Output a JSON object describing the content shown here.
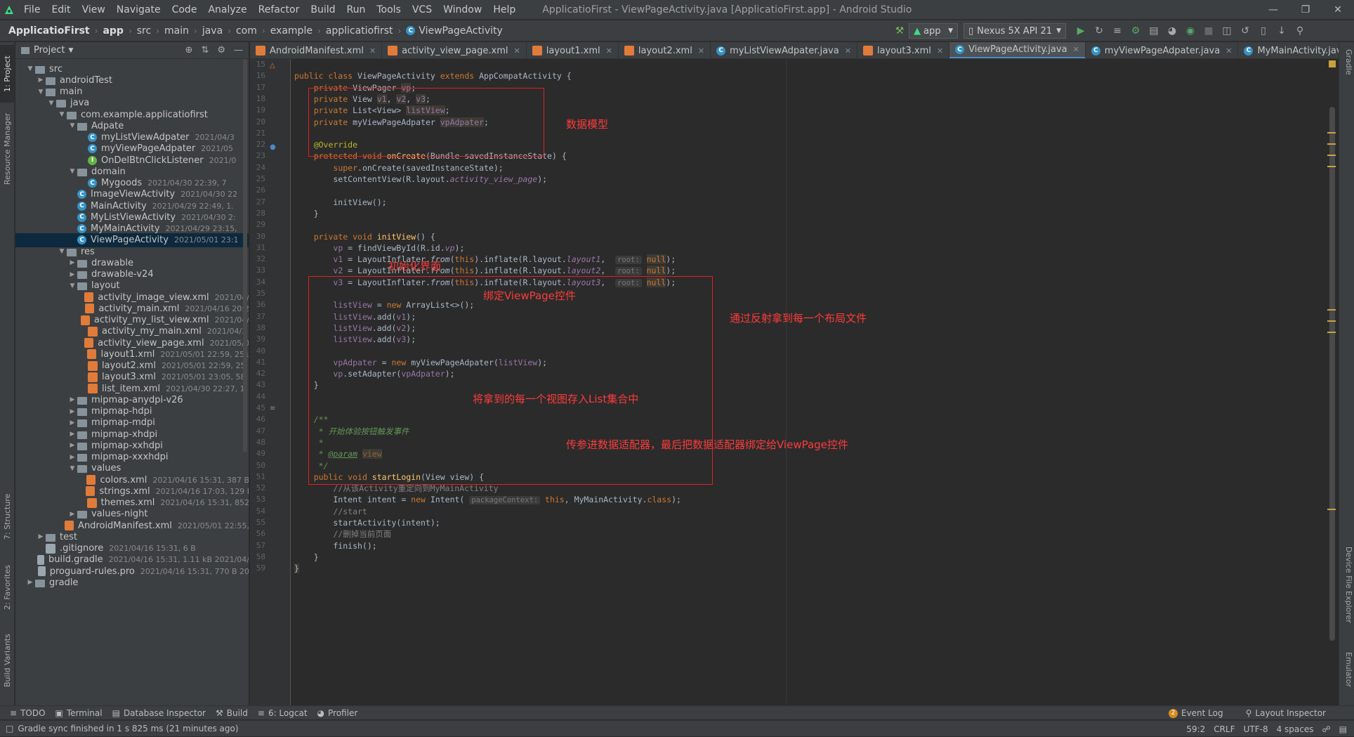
{
  "menubar": {
    "items": [
      "File",
      "Edit",
      "View",
      "Navigate",
      "Code",
      "Analyze",
      "Refactor",
      "Build",
      "Run",
      "Tools",
      "VCS",
      "Window",
      "Help"
    ],
    "window_title": "ApplicatioFirst - ViewPageActivity.java [ApplicatioFirst.app] - Android Studio"
  },
  "breadcrumb": [
    "ApplicatioFirst",
    "app",
    "src",
    "main",
    "java",
    "com",
    "example",
    "applicatiofirst",
    "ViewPageActivity"
  ],
  "toolbar": {
    "run_config": "app",
    "device": "Nexus 5X API 21"
  },
  "project_panel": {
    "title": "Project",
    "tree": [
      {
        "label": "src",
        "depth": 0,
        "type": "folder",
        "open": true,
        "meta": ""
      },
      {
        "label": "androidTest",
        "depth": 1,
        "type": "folder",
        "open": false,
        "meta": ""
      },
      {
        "label": "main",
        "depth": 1,
        "type": "folder",
        "open": true,
        "meta": ""
      },
      {
        "label": "java",
        "depth": 2,
        "type": "folder",
        "open": true,
        "meta": ""
      },
      {
        "label": "com.example.applicatiofirst",
        "depth": 3,
        "type": "folder",
        "open": true,
        "meta": ""
      },
      {
        "label": "Adpate",
        "depth": 4,
        "type": "folder",
        "open": true,
        "meta": ""
      },
      {
        "label": "myListViewAdpater",
        "depth": 5,
        "type": "cls",
        "meta": "2021/04/3"
      },
      {
        "label": "myViewPageAdpater",
        "depth": 5,
        "type": "cls",
        "meta": "2021/05"
      },
      {
        "label": "OnDelBtnClickListener",
        "depth": 5,
        "type": "intf",
        "meta": "2021/0"
      },
      {
        "label": "domain",
        "depth": 4,
        "type": "folder",
        "open": true,
        "meta": ""
      },
      {
        "label": "Mygoods",
        "depth": 5,
        "type": "cls",
        "meta": "2021/04/30 22:39, 7"
      },
      {
        "label": "ImageViewActivity",
        "depth": 4,
        "type": "cls",
        "meta": "2021/04/30 22"
      },
      {
        "label": "MainActivity",
        "depth": 4,
        "type": "cls",
        "meta": "2021/04/29 22:49, 1."
      },
      {
        "label": "MyListViewActivity",
        "depth": 4,
        "type": "cls",
        "meta": "2021/04/30 2:"
      },
      {
        "label": "MyMainActivity",
        "depth": 4,
        "type": "cls",
        "meta": "2021/04/29 23:15,"
      },
      {
        "label": "ViewPageActivity",
        "depth": 4,
        "type": "cls",
        "meta": "2021/05/01 23:1",
        "selected": true
      },
      {
        "label": "res",
        "depth": 3,
        "type": "folder",
        "open": true,
        "meta": ""
      },
      {
        "label": "drawable",
        "depth": 4,
        "type": "folder",
        "open": false,
        "meta": ""
      },
      {
        "label": "drawable-v24",
        "depth": 4,
        "type": "folder",
        "open": false,
        "meta": ""
      },
      {
        "label": "layout",
        "depth": 4,
        "type": "folder",
        "open": true,
        "meta": ""
      },
      {
        "label": "activity_image_view.xml",
        "depth": 5,
        "type": "xml",
        "meta": "2021/04/"
      },
      {
        "label": "activity_main.xml",
        "depth": 5,
        "type": "xml",
        "meta": "2021/04/16 20:2"
      },
      {
        "label": "activity_my_list_view.xml",
        "depth": 5,
        "type": "xml",
        "meta": "2021/04/"
      },
      {
        "label": "activity_my_main.xml",
        "depth": 5,
        "type": "xml",
        "meta": "2021/04/3"
      },
      {
        "label": "activity_view_page.xml",
        "depth": 5,
        "type": "xml",
        "meta": "2021/05/0"
      },
      {
        "label": "layout1.xml",
        "depth": 5,
        "type": "xml",
        "meta": "2021/05/01 22:59, 251"
      },
      {
        "label": "layout2.xml",
        "depth": 5,
        "type": "xml",
        "meta": "2021/05/01 22:59, 25"
      },
      {
        "label": "layout3.xml",
        "depth": 5,
        "type": "xml",
        "meta": "2021/05/01 23:05, 58"
      },
      {
        "label": "list_item.xml",
        "depth": 5,
        "type": "xml",
        "meta": "2021/04/30 22:27, 1"
      },
      {
        "label": "mipmap-anydpi-v26",
        "depth": 4,
        "type": "folder",
        "open": false,
        "meta": ""
      },
      {
        "label": "mipmap-hdpi",
        "depth": 4,
        "type": "folder",
        "open": false,
        "meta": ""
      },
      {
        "label": "mipmap-mdpi",
        "depth": 4,
        "type": "folder",
        "open": false,
        "meta": ""
      },
      {
        "label": "mipmap-xhdpi",
        "depth": 4,
        "type": "folder",
        "open": false,
        "meta": ""
      },
      {
        "label": "mipmap-xxhdpi",
        "depth": 4,
        "type": "folder",
        "open": false,
        "meta": ""
      },
      {
        "label": "mipmap-xxxhdpi",
        "depth": 4,
        "type": "folder",
        "open": false,
        "meta": ""
      },
      {
        "label": "values",
        "depth": 4,
        "type": "folder",
        "open": true,
        "meta": ""
      },
      {
        "label": "colors.xml",
        "depth": 5,
        "type": "xml",
        "meta": "2021/04/16 15:31, 387 B"
      },
      {
        "label": "strings.xml",
        "depth": 5,
        "type": "xml",
        "meta": "2021/04/16 17:03, 129 I"
      },
      {
        "label": "themes.xml",
        "depth": 5,
        "type": "xml",
        "meta": "2021/04/16 15:31, 852"
      },
      {
        "label": "values-night",
        "depth": 4,
        "type": "folder",
        "open": false,
        "meta": ""
      },
      {
        "label": "AndroidManifest.xml",
        "depth": 3,
        "type": "xml",
        "meta": "2021/05/01 22:55,"
      },
      {
        "label": "test",
        "depth": 1,
        "type": "folder",
        "open": false,
        "meta": ""
      },
      {
        "label": ".gitignore",
        "depth": 1,
        "type": "file",
        "meta": "2021/04/16 15:31, 6 B"
      },
      {
        "label": "build.gradle",
        "depth": 1,
        "type": "file",
        "meta": "2021/04/16 15:31, 1.11 kB 2021/04/"
      },
      {
        "label": "proguard-rules.pro",
        "depth": 1,
        "type": "file",
        "meta": "2021/04/16 15:31, 770 B 20"
      },
      {
        "label": "gradle",
        "depth": 0,
        "type": "folder",
        "open": false,
        "meta": ""
      }
    ]
  },
  "tabs": [
    {
      "label": "AndroidManifest.xml",
      "icon": "xml"
    },
    {
      "label": "activity_view_page.xml",
      "icon": "xml"
    },
    {
      "label": "layout1.xml",
      "icon": "xml"
    },
    {
      "label": "layout2.xml",
      "icon": "xml"
    },
    {
      "label": "myListViewAdpater.java",
      "icon": "cls"
    },
    {
      "label": "layout3.xml",
      "icon": "xml"
    },
    {
      "label": "ViewPageActivity.java",
      "icon": "cls",
      "active": true
    },
    {
      "label": "myViewPageAdpater.java",
      "icon": "cls"
    },
    {
      "label": "MyMainActivity.java",
      "icon": "cls"
    },
    {
      "label": "MainActivity.j",
      "icon": "cls"
    }
  ],
  "line_numbers": [
    "15",
    "16",
    "17",
    "18",
    "19",
    "20",
    "21",
    "22",
    "23",
    "24",
    "25",
    "26",
    "27",
    "28",
    "29",
    "30",
    "31",
    "32",
    "33",
    "34",
    "35",
    "36",
    "37",
    "38",
    "39",
    "40",
    "41",
    "42",
    "43",
    "44",
    "45",
    "46",
    "47",
    "48",
    "49",
    "50",
    "51",
    "52",
    "53",
    "54",
    "55",
    "56",
    "57",
    "58",
    "59"
  ],
  "code_lines": [
    "",
    "<span class='k'>public class </span>ViewPageActivity <span class='k'>extends </span>AppCompatActivity {",
    "    <span class='k'>private </span>ViewPager <span class='pu hl'>vp</span>;",
    "    <span class='k'>private </span>View <span class='pu hl'>v1</span>, <span class='pu hl'>v2</span>, <span class='pu hl'>v3</span>;",
    "    <span class='k'>private </span>List&lt;View&gt; <span class='pu hl'>listView</span>;",
    "    <span class='k'>private </span>myViewPageAdpater <span class='pu hl'>vpAdpater</span>;",
    "",
    "    <span class='an'>@Override</span>",
    "    <span class='k'>protected void </span><span class='f'>onCreate</span>(Bundle savedInstanceState) {",
    "        <span class='k'>super</span>.onCreate(savedInstanceState);",
    "        setContentView(R.layout.<span class='pu it'>activity_view_page</span>);",
    "",
    "        initView();",
    "    }",
    "",
    "    <span class='k'>private void </span><span class='f'>initView</span>() {",
    "        <span class='pu'>vp</span> = findViewById(R.id.<span class='pu it'>vp</span>);",
    "        <span class='pu'>v1</span> = LayoutInflater.<span class='it'>from</span>(<span class='k'>this</span>).inflate(R.layout.<span class='pu it'>layout1</span>,  <span class='hint'>root:</span> <span class='k hl'>null</span>);",
    "        <span class='pu'>v2</span> = LayoutInflater.<span class='it'>from</span>(<span class='k'>this</span>).inflate(R.layout.<span class='pu it'>layout2</span>,  <span class='hint'>root:</span> <span class='k hl'>null</span>);",
    "        <span class='pu'>v3</span> = LayoutInflater.<span class='it'>from</span>(<span class='k'>this</span>).inflate(R.layout.<span class='pu it'>layout3</span>,  <span class='hint'>root:</span> <span class='k hl'>null</span>);",
    "",
    "        <span class='pu'>listView</span> = <span class='k'>new </span>ArrayList&lt;&gt;();",
    "        <span class='pu'>listView</span>.add(<span class='pu'>v1</span>);",
    "        <span class='pu'>listView</span>.add(<span class='pu'>v2</span>);",
    "        <span class='pu'>listView</span>.add(<span class='pu'>v3</span>);",
    "",
    "        <span class='pu'>vpAdpater</span> = <span class='k'>new </span>myViewPageAdpater(<span class='pu'>listView</span>);",
    "        <span class='pu'>vp</span>.setAdapter(<span class='pu'>vpAdpater</span>);",
    "    }",
    "",
    "",
    "    <span class='cmi'>/**</span>",
    "<span class='cmi'>     * 开始体验按钮触发事件</span>",
    "<span class='cmi'>     *</span>",
    "<span class='cmi'>     * </span><span class='cmi' style='text-decoration:underline'>@param</span> <span class='hl' style='color:#8a653b'>view</span>",
    "<span class='cmi'>     */</span>",
    "    <span class='k'>public void </span><span class='f'>startLogin</span>(View view) {",
    "        <span class='cm'>//从该Activity重定向到MyMainActivity</span>",
    "        Intent intent = <span class='k'>new </span>Intent( <span class='hint'>packageContext:</span> <span class='k'>this</span>, MyMainActivity.<span class='k'>class</span>);",
    "        <span class='cm'>//start</span>",
    "        startActivity(intent);",
    "        <span class='cm'>//删掉当前页面</span>",
    "        finish();",
    "    }",
    "<span class='hl'>}</span>"
  ],
  "annotations": [
    {
      "text": "数据模型"
    },
    {
      "text": "初始化界面"
    },
    {
      "text": "绑定ViewPage控件"
    },
    {
      "text": "通过反射拿到每一个布局文件"
    },
    {
      "text": "将拿到的每一个视图存入List集合中"
    },
    {
      "text": "传参进数据适配器，最后把数据适配器绑定给ViewPage控件"
    }
  ],
  "left_stripe": [
    "1: Project",
    "Resource Manager",
    "7: Structure",
    "2: Favorites",
    "Build Variants"
  ],
  "right_stripe": [
    "Gradle",
    "Device File Explorer",
    "Emulator"
  ],
  "bottom_tools": [
    "TODO",
    "Terminal",
    "Database Inspector",
    "Build",
    "6: Logcat",
    "Profiler"
  ],
  "bottom_right_tools": [
    "Event Log",
    "Layout Inspector"
  ],
  "event_log_count": "2",
  "status": {
    "message": "Gradle sync finished in 1 s 825 ms (21 minutes ago)",
    "position": "59:2",
    "line_sep": "CRLF",
    "encoding": "UTF-8",
    "indent": "4 spaces"
  },
  "colors": {
    "accent": "#4a88c7",
    "annotation": "#ff3b3b",
    "selection": "#0d293e"
  }
}
